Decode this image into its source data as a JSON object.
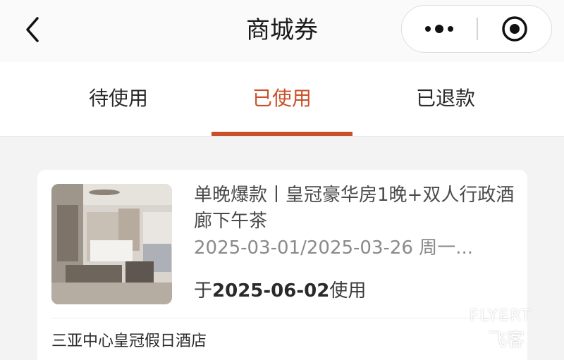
{
  "header": {
    "title": "商城券",
    "back_icon": "chevron-left-icon",
    "more_icon": "more-dots-icon",
    "target_icon": "target-close-icon"
  },
  "tabs": [
    {
      "label": "待使用",
      "active": false
    },
    {
      "label": "已使用",
      "active": true
    },
    {
      "label": "已退款",
      "active": false
    }
  ],
  "colors": {
    "accent": "#c9512a",
    "background": "#f3f3f3",
    "card": "#ffffff"
  },
  "coupon": {
    "title": "单晚爆款丨皇冠豪华房1晚+双人行政酒廊下午茶",
    "dates": "2025-03-01/2025-03-26 周一...",
    "used_prefix": "于",
    "used_date": "2025-06-02",
    "used_suffix": "使用",
    "hotel": "三亚中心皇冠假日酒店"
  },
  "watermark": {
    "brand": "FLYERT",
    "brand_cn": "飞客"
  }
}
